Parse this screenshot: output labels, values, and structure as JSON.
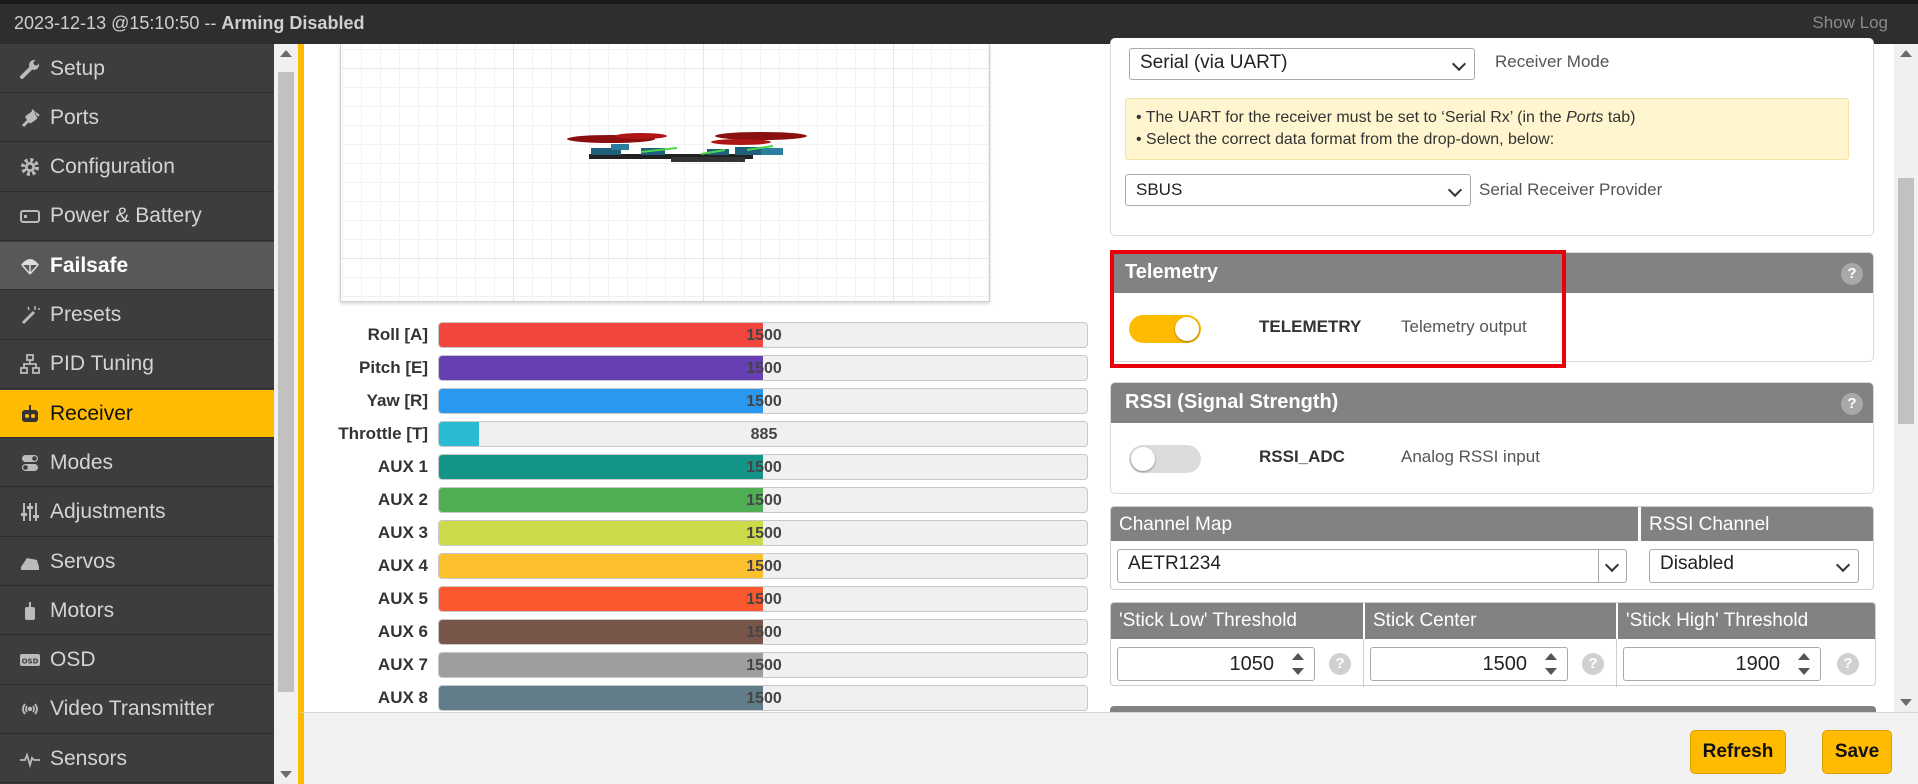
{
  "header": {
    "status_time": "2023-12-13 @15:10:50 --",
    "status_state": "Arming Disabled",
    "show_log": "Show Log"
  },
  "sidebar": {
    "items": [
      {
        "label": "Setup",
        "icon": "wrench-icon"
      },
      {
        "label": "Ports",
        "icon": "plug-icon"
      },
      {
        "label": "Configuration",
        "icon": "gear-icon"
      },
      {
        "label": "Power & Battery",
        "icon": "battery-icon"
      },
      {
        "label": "Failsafe",
        "icon": "parachute-icon"
      },
      {
        "label": "Presets",
        "icon": "magic-wand-icon"
      },
      {
        "label": "PID Tuning",
        "icon": "sitemap-icon"
      },
      {
        "label": "Receiver",
        "icon": "robot-icon"
      },
      {
        "label": "Modes",
        "icon": "toggles-icon"
      },
      {
        "label": "Adjustments",
        "icon": "sliders-icon"
      },
      {
        "label": "Servos",
        "icon": "servo-icon"
      },
      {
        "label": "Motors",
        "icon": "motor-icon"
      },
      {
        "label": "OSD",
        "icon": "osd-icon"
      },
      {
        "label": "Video Transmitter",
        "icon": "broadcast-icon"
      },
      {
        "label": "Sensors",
        "icon": "pulse-icon"
      }
    ],
    "hovered": "Failsafe",
    "active": "Receiver"
  },
  "channels": [
    {
      "name": "Roll [A]",
      "value": "1500",
      "fill": 0.5,
      "color": "#f1453d"
    },
    {
      "name": "Pitch [E]",
      "value": "1500",
      "fill": 0.5,
      "color": "#673fb4"
    },
    {
      "name": "Yaw [R]",
      "value": "1500",
      "fill": 0.5,
      "color": "#2b98f0"
    },
    {
      "name": "Throttle [T]",
      "value": "885",
      "fill": 0.062,
      "color": "#29bbd4"
    },
    {
      "name": "AUX 1",
      "value": "1500",
      "fill": 0.5,
      "color": "#159588"
    },
    {
      "name": "AUX 2",
      "value": "1500",
      "fill": 0.5,
      "color": "#50ae55"
    },
    {
      "name": "AUX 3",
      "value": "1500",
      "fill": 0.5,
      "color": "#cdda49"
    },
    {
      "name": "AUX 4",
      "value": "1500",
      "fill": 0.5,
      "color": "#fdc02f"
    },
    {
      "name": "AUX 5",
      "value": "1500",
      "fill": 0.5,
      "color": "#fc5830"
    },
    {
      "name": "AUX 6",
      "value": "1500",
      "fill": 0.5,
      "color": "#785549"
    },
    {
      "name": "AUX 7",
      "value": "1500",
      "fill": 0.5,
      "color": "#9e9e9e"
    },
    {
      "name": "AUX 8",
      "value": "1500",
      "fill": 0.5,
      "color": "#617d8a"
    }
  ],
  "receiver": {
    "mode_value": "Serial (via UART)",
    "mode_label": "Receiver Mode",
    "note_line1_prefix": "• The UART for the receiver must be set to ‘Serial Rx’ (in the ",
    "note_line1_em": "Ports",
    "note_line1_suffix": " tab)",
    "note_line2": "• Select the correct data format from the drop-down, below:",
    "provider_value": "SBUS",
    "provider_label": "Serial Receiver Provider"
  },
  "telemetry": {
    "title": "Telemetry",
    "feature": "TELEMETRY",
    "description": "Telemetry output",
    "enabled": true,
    "help": "?"
  },
  "rssi": {
    "title": "RSSI (Signal Strength)",
    "feature": "RSSI_ADC",
    "description": "Analog RSSI input",
    "enabled": false,
    "help": "?"
  },
  "channel_map": {
    "header": "Channel Map",
    "value": "AETR1234",
    "rssi_header": "RSSI Channel",
    "rssi_value": "Disabled"
  },
  "sticks": {
    "low_header": "'Stick Low' Threshold",
    "low_value": "1050",
    "center_header": "Stick Center",
    "center_value": "1500",
    "high_header": "'Stick High' Threshold",
    "high_value": "1900",
    "help": "?"
  },
  "footer": {
    "refresh": "Refresh",
    "save": "Save"
  },
  "colors": {
    "accent": "#ffbb00",
    "highlight_box": "#e8000d",
    "panel_header": "#828282"
  }
}
